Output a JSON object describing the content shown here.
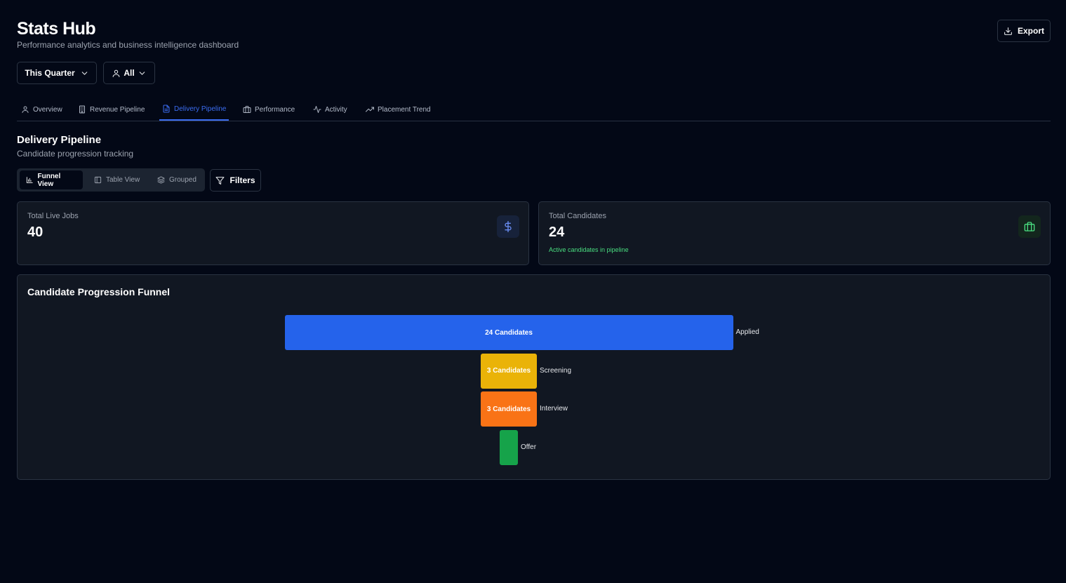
{
  "header": {
    "title": "Stats Hub",
    "subtitle": "Performance analytics and business intelligence dashboard",
    "export_label": "Export"
  },
  "filters": {
    "period": "This Quarter",
    "owner": "All"
  },
  "tabs": [
    {
      "label": "Overview",
      "icon": "user-icon"
    },
    {
      "label": "Revenue Pipeline",
      "icon": "building-icon"
    },
    {
      "label": "Delivery Pipeline",
      "icon": "file-icon",
      "active": true
    },
    {
      "label": "Performance",
      "icon": "briefcase-icon"
    },
    {
      "label": "Activity",
      "icon": "activity-icon"
    },
    {
      "label": "Placement Trend",
      "icon": "trending-up-icon"
    }
  ],
  "section": {
    "title": "Delivery Pipeline",
    "subtitle": "Candidate progression tracking"
  },
  "view_toggle": {
    "funnel": "Funnel View",
    "table": "Table View",
    "grouped": "Grouped",
    "selected": "Funnel View"
  },
  "filters_button": "Filters",
  "stats": {
    "jobs": {
      "label": "Total Live Jobs",
      "value": "40",
      "icon": "dollar-icon"
    },
    "candidates": {
      "label": "Total Candidates",
      "value": "24",
      "note": "Active candidates in pipeline",
      "icon": "briefcase-icon"
    }
  },
  "funnel": {
    "title": "Candidate Progression Funnel",
    "stages": [
      {
        "name": "Applied",
        "count": 24,
        "label": "24 Candidates",
        "color": "#2563eb"
      },
      {
        "name": "Screening",
        "count": 3,
        "label": "3 Candidates",
        "color": "#eab308"
      },
      {
        "name": "Interview",
        "count": 3,
        "label": "3 Candidates",
        "color": "#f97316"
      },
      {
        "name": "Offer",
        "count": 1,
        "label": "",
        "color": "#16a34a"
      }
    ]
  },
  "colors": {
    "background": "#030816",
    "card": "#111722",
    "accent": "#3b6df2",
    "success": "#4ade80"
  }
}
